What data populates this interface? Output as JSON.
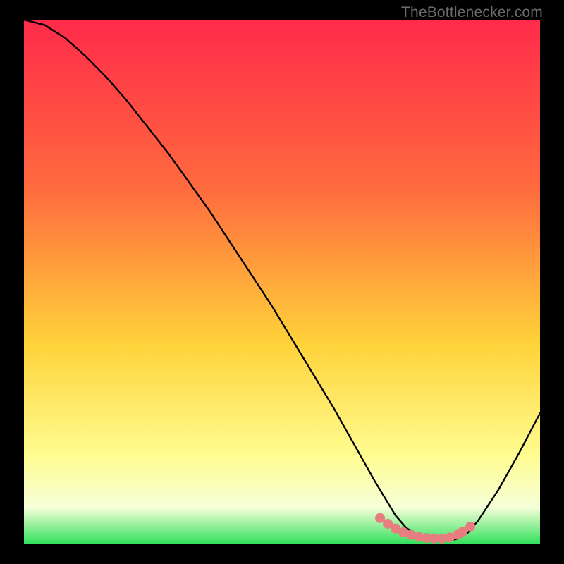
{
  "watermark": "TheBottlenecker.com",
  "colors": {
    "frame": "#000000",
    "grad_top": "#ff2a4a",
    "grad_mid_a": "#ff6a3e",
    "grad_mid_b": "#ffd33a",
    "grad_low": "#fffc90",
    "grad_pale": "#f6ffd8",
    "grad_green": "#2fe05a",
    "curve": "#000000",
    "marker": "#e77d7e",
    "watermark": "#6c6c6c"
  },
  "chart_data": {
    "type": "line",
    "title": "",
    "xlabel": "",
    "ylabel": "",
    "xlim": [
      0,
      100
    ],
    "ylim": [
      0,
      100
    ],
    "series": [
      {
        "name": "bottleneck-curve",
        "x": [
          0,
          4,
          8,
          12,
          16,
          20,
          24,
          28,
          32,
          36,
          40,
          44,
          48,
          52,
          56,
          60,
          64,
          68,
          72,
          74,
          76,
          78,
          80,
          82,
          84,
          86,
          88,
          92,
          96,
          100
        ],
        "y": [
          100,
          99,
          96.5,
          93,
          89,
          84.5,
          79.5,
          74.5,
          69,
          63.5,
          57.5,
          51.5,
          45.5,
          39,
          32.5,
          26,
          19,
          12,
          5.5,
          3.2,
          1.8,
          1.0,
          0.7,
          0.7,
          1.0,
          2.2,
          4.5,
          10.5,
          17.5,
          25
        ]
      }
    ],
    "markers": {
      "name": "optimal-range",
      "x": [
        69,
        70.5,
        72,
        73.5,
        75,
        76.5,
        78,
        79.5,
        81,
        82.5,
        84,
        85,
        86.5
      ],
      "y": [
        5.0,
        3.9,
        3.0,
        2.3,
        1.8,
        1.4,
        1.2,
        1.1,
        1.1,
        1.3,
        1.8,
        2.4,
        3.4
      ]
    }
  }
}
